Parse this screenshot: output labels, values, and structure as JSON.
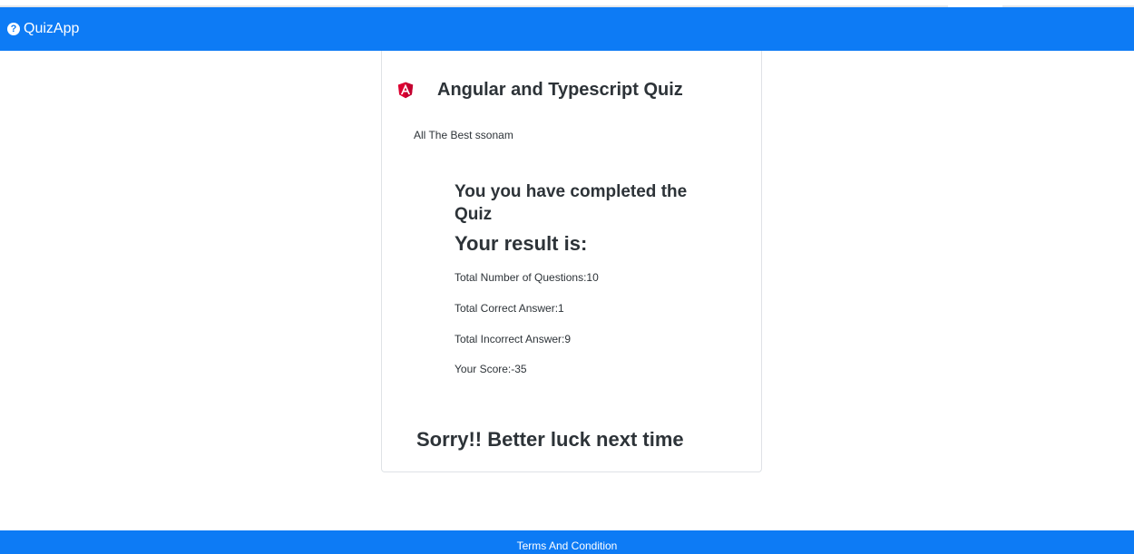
{
  "navbar": {
    "brand": "QuizApp",
    "brand_icon": "question-circle-icon"
  },
  "quiz": {
    "logo_icon": "angular-logo-icon",
    "title": "Angular and Typescript Quiz",
    "greeting": "All The Best ssonam",
    "completed_message": "You you have completed the Quiz",
    "result_heading": "Your result is:",
    "stats": [
      "Total Number of Questions:10",
      "Total Correct Answer:1",
      "Total Incorrect Answer:9",
      "Your Score:-35"
    ],
    "closing_message": "Sorry!! Better luck next time"
  },
  "footer": {
    "link": "Terms And Condition"
  },
  "colors": {
    "primary": "#0d7bf5",
    "angular_red": "#dd0031",
    "angular_dark_red": "#c3002f"
  }
}
